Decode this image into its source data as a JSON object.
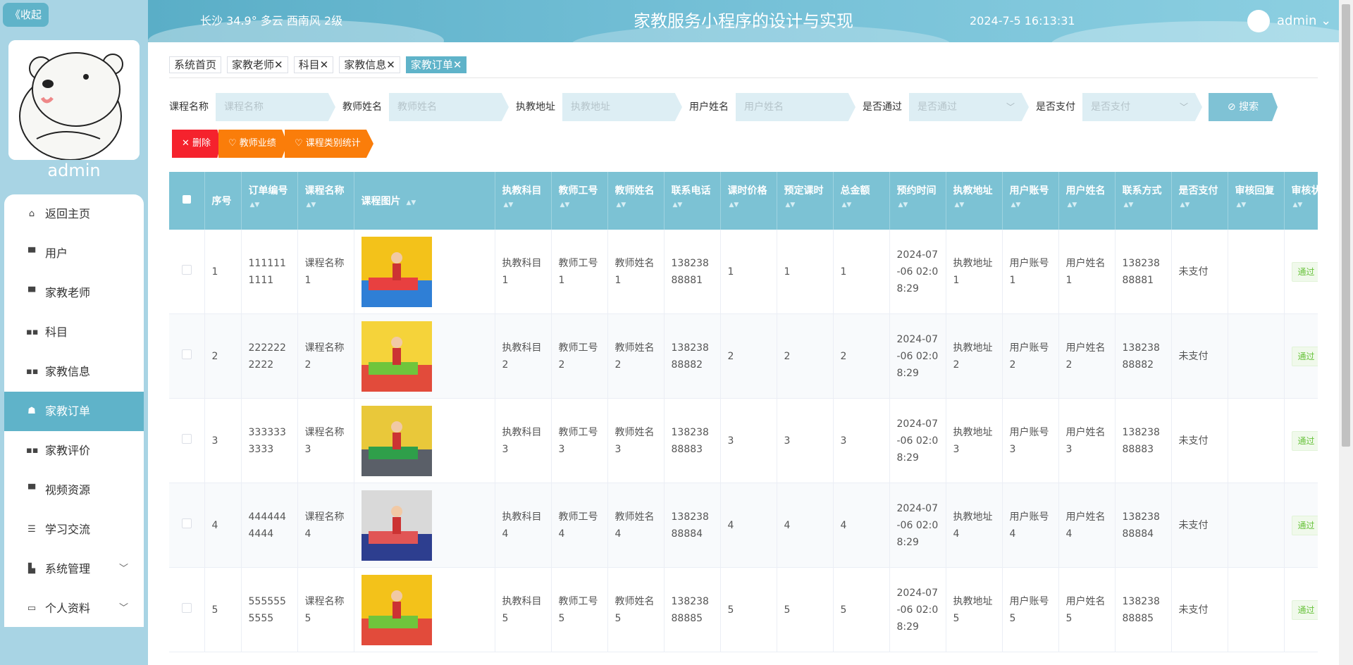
{
  "sidebar": {
    "collapse_label": "《收起",
    "username": "admin",
    "items": [
      {
        "label": "返回主页",
        "icon": "home-icon"
      },
      {
        "label": "用户",
        "icon": "user-icon"
      },
      {
        "label": "家教老师",
        "icon": "teacher-icon"
      },
      {
        "label": "科目",
        "icon": "grid-icon"
      },
      {
        "label": "家教信息",
        "icon": "grid-icon"
      },
      {
        "label": "家教订单",
        "icon": "person-icon",
        "active": true
      },
      {
        "label": "家教评价",
        "icon": "grid-icon"
      },
      {
        "label": "视频资源",
        "icon": "monitor-icon"
      },
      {
        "label": "学习交流",
        "icon": "list-icon"
      },
      {
        "label": "系统管理",
        "icon": "chart-icon",
        "expandable": true
      },
      {
        "label": "个人资料",
        "icon": "card-icon",
        "expandable": true
      }
    ]
  },
  "header": {
    "weather": "长沙  34.9°  多云  西南风  2级",
    "title": "家教服务小程序的设计与实现",
    "datetime": "2024-7-5 16:13:31",
    "user": "admin ⌄"
  },
  "tabs": [
    {
      "label": "系统首页",
      "closable": false
    },
    {
      "label": "家教老师",
      "closable": true
    },
    {
      "label": "科目",
      "closable": true
    },
    {
      "label": "家教信息",
      "closable": true
    },
    {
      "label": "家教订单",
      "closable": true,
      "active": true
    }
  ],
  "filters": {
    "course_name": {
      "label": "课程名称",
      "placeholder": "课程名称"
    },
    "teacher_name": {
      "label": "教师姓名",
      "placeholder": "教师姓名"
    },
    "address": {
      "label": "执教地址",
      "placeholder": "执教地址"
    },
    "user_name": {
      "label": "用户姓名",
      "placeholder": "用户姓名"
    },
    "passed": {
      "label": "是否通过",
      "placeholder": "是否通过"
    },
    "paid": {
      "label": "是否支付",
      "placeholder": "是否支付"
    },
    "search_label": "⊘ 搜索"
  },
  "actions": {
    "delete": "✕  删除",
    "teacher_perf": "♡  教师业绩",
    "category_stats": "♡  课程类别统计"
  },
  "table": {
    "columns": [
      "序号",
      "订单编号",
      "课程名称",
      "课程图片",
      "执教科目",
      "教师工号",
      "教师姓名",
      "联系电话",
      "课时价格",
      "预定课时",
      "总金额",
      "预约时间",
      "执教地址",
      "用户账号",
      "用户姓名",
      "联系方式",
      "是否支付",
      "审核回复",
      "审核状态"
    ],
    "rows": [
      {
        "idx": "1",
        "order_no": "1111111111",
        "course": "课程名称1",
        "subject": "执教科目1",
        "teacher_id": "教师工号1",
        "teacher": "教师姓名1",
        "phone": "13823888881",
        "price": "1",
        "hours": "1",
        "total": "1",
        "time": "2024-07-06 02:08:29",
        "address": "执教地址1",
        "account": "用户账号1",
        "uname": "用户姓名1",
        "contact": "13823888881",
        "paid": "未支付",
        "reply": "",
        "status": "通过"
      },
      {
        "idx": "2",
        "order_no": "2222222222",
        "course": "课程名称2",
        "subject": "执教科目2",
        "teacher_id": "教师工号2",
        "teacher": "教师姓名2",
        "phone": "13823888882",
        "price": "2",
        "hours": "2",
        "total": "2",
        "time": "2024-07-06 02:08:29",
        "address": "执教地址2",
        "account": "用户账号2",
        "uname": "用户姓名2",
        "contact": "13823888882",
        "paid": "未支付",
        "reply": "",
        "status": "通过"
      },
      {
        "idx": "3",
        "order_no": "3333333333",
        "course": "课程名称3",
        "subject": "执教科目3",
        "teacher_id": "教师工号3",
        "teacher": "教师姓名3",
        "phone": "13823888883",
        "price": "3",
        "hours": "3",
        "total": "3",
        "time": "2024-07-06 02:08:29",
        "address": "执教地址3",
        "account": "用户账号3",
        "uname": "用户姓名3",
        "contact": "13823888883",
        "paid": "未支付",
        "reply": "",
        "status": "通过"
      },
      {
        "idx": "4",
        "order_no": "4444444444",
        "course": "课程名称4",
        "subject": "执教科目4",
        "teacher_id": "教师工号4",
        "teacher": "教师姓名4",
        "phone": "13823888884",
        "price": "4",
        "hours": "4",
        "total": "4",
        "time": "2024-07-06 02:08:29",
        "address": "执教地址4",
        "account": "用户账号4",
        "uname": "用户姓名4",
        "contact": "13823888884",
        "paid": "未支付",
        "reply": "",
        "status": "通过"
      },
      {
        "idx": "5",
        "order_no": "5555555555",
        "course": "课程名称5",
        "subject": "执教科目5",
        "teacher_id": "教师工号5",
        "teacher": "教师姓名5",
        "phone": "13823888885",
        "price": "5",
        "hours": "5",
        "total": "5",
        "time": "2024-07-06 02:08:29",
        "address": "执教地址5",
        "account": "用户账号5",
        "uname": "用户姓名5",
        "contact": "13823888885",
        "paid": "未支付",
        "reply": "",
        "status": "通过"
      }
    ]
  },
  "colors": {
    "accent": "#5fb3c9",
    "header_row": "#7cc2d4",
    "delete": "#f5222d",
    "orange": "#fa7d0a"
  }
}
